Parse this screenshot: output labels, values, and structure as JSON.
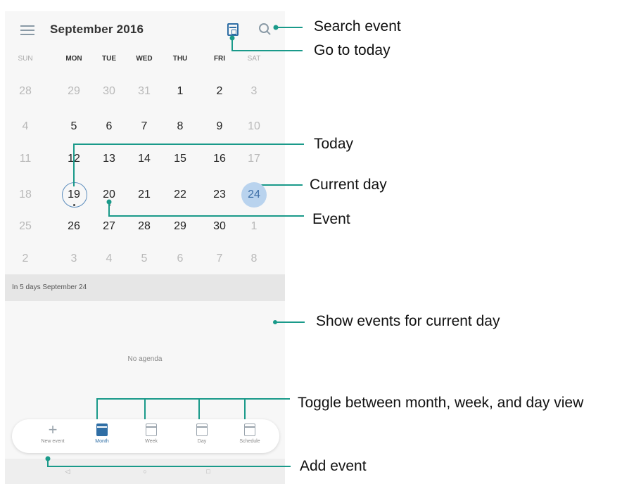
{
  "header": {
    "month_title": "September 2016"
  },
  "weekdays": [
    "SUN",
    "MON",
    "TUE",
    "WED",
    "THU",
    "FRI",
    "SAT"
  ],
  "weeks": [
    [
      "28",
      "29",
      "30",
      "31",
      "1",
      "2",
      "3"
    ],
    [
      "4",
      "5",
      "6",
      "7",
      "8",
      "9",
      "10"
    ],
    [
      "11",
      "12",
      "13",
      "14",
      "15",
      "16",
      "17"
    ],
    [
      "18",
      "19",
      "20",
      "21",
      "22",
      "23",
      "24"
    ],
    [
      "25",
      "26",
      "27",
      "28",
      "29",
      "30",
      "1"
    ],
    [
      "2",
      "3",
      "4",
      "5",
      "6",
      "7",
      "8"
    ]
  ],
  "today": "19",
  "selected_day": "24",
  "agenda": {
    "header": "In 5 days  September 24",
    "empty_text": "No agenda"
  },
  "bottom_tabs": [
    {
      "label": "New event",
      "icon": "plus-icon"
    },
    {
      "label": "Month",
      "icon": "month-view-icon"
    },
    {
      "label": "Week",
      "icon": "week-view-icon"
    },
    {
      "label": "Day",
      "icon": "day-view-icon"
    },
    {
      "label": "Schedule",
      "icon": "schedule-icon"
    }
  ],
  "active_tab": "Month",
  "callouts": {
    "search_event": "Search event",
    "go_to_today": "Go to today",
    "today": "Today",
    "current_day": "Current day",
    "event": "Event",
    "show_events": "Show events for current day",
    "toggle_view": "Toggle between month, week, and day view",
    "add_event": "Add event"
  },
  "colors": {
    "accent": "#2f6ea5",
    "selected_bg": "#b9d3ee",
    "callout_line": "#1a9a8a"
  }
}
